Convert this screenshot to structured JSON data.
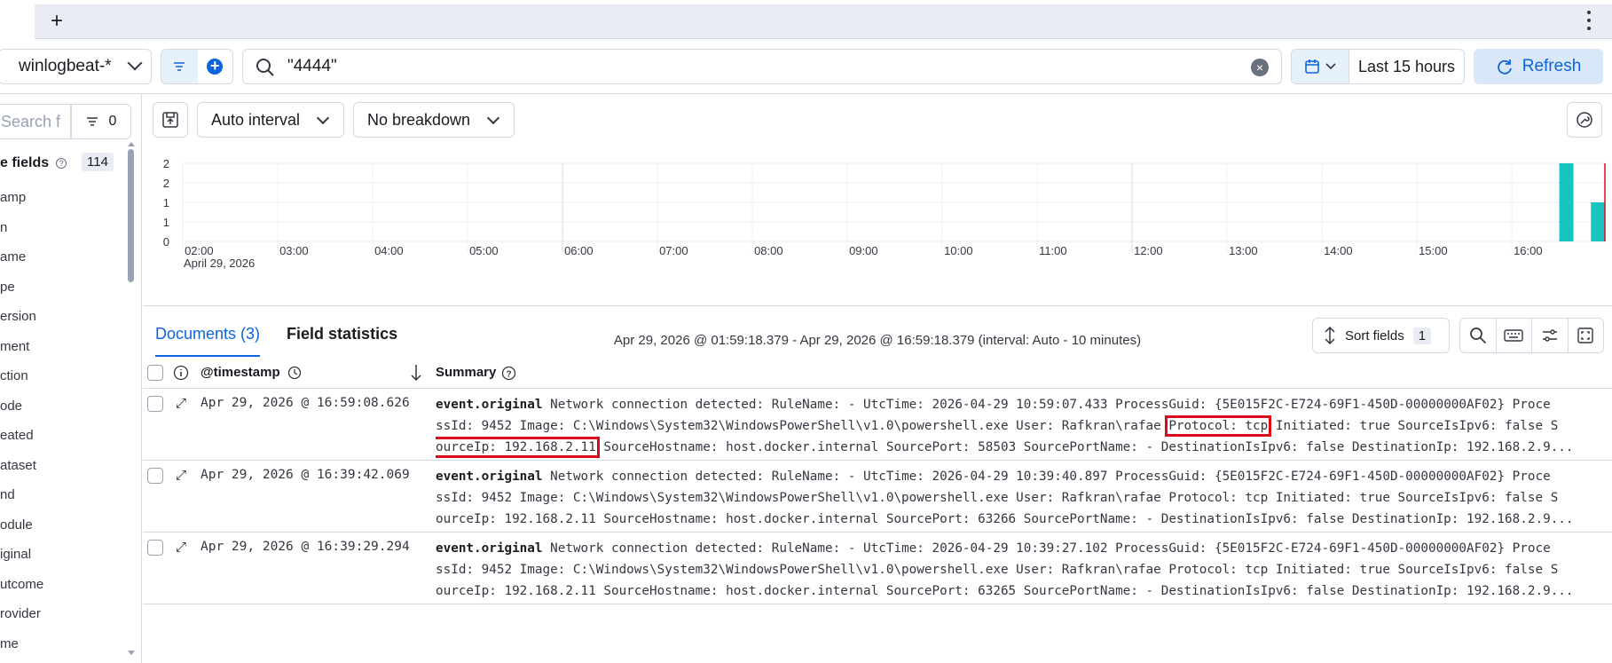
{
  "topbar": {
    "add_tab": "+"
  },
  "querybar": {
    "dataview": "winlogbeat-*",
    "query": "\"4444\"",
    "time_range": "Last 15 hours",
    "refresh": "Refresh"
  },
  "sidebar": {
    "search_placeholder": "Search f",
    "filter_count": "0",
    "section_title": "e fields",
    "section_count": "114",
    "items": [
      "amp",
      "n",
      "ame",
      "pe",
      "ersion",
      "ment",
      "ction",
      "ode",
      "eated",
      "ataset",
      "nd",
      "odule",
      "iginal",
      "utcome",
      "rovider",
      "me"
    ]
  },
  "toolbar": {
    "interval": "Auto interval",
    "breakdown": "No breakdown"
  },
  "chart_data": {
    "type": "bar",
    "y_ticks": [
      "0",
      "1",
      "1",
      "2",
      "2"
    ],
    "x_ticks": [
      "02:00",
      "03:00",
      "04:00",
      "05:00",
      "06:00",
      "07:00",
      "08:00",
      "09:00",
      "10:00",
      "11:00",
      "12:00",
      "13:00",
      "14:00",
      "15:00",
      "16:00"
    ],
    "x_sublabel": "April 29, 2026",
    "bars": [
      {
        "time": "16:30",
        "value": 2
      },
      {
        "time": "16:50",
        "value": 1
      }
    ],
    "ylim": [
      0,
      2
    ],
    "bar_color": "#16c5c0",
    "now_marker_color": "#dd0a1a"
  },
  "histogram": {
    "range_text": "Apr 29, 2026 @ 01:59:18.379 - Apr 29, 2026 @ 16:59:18.379 (interval: Auto - 10 minutes)"
  },
  "tabs": {
    "documents": "Documents (3)",
    "field_stats": "Field statistics"
  },
  "grid": {
    "sort_fields": "Sort fields",
    "sort_count": "1",
    "col_timestamp": "@timestamp",
    "col_summary": "Summary",
    "rows": [
      {
        "timestamp": "Apr 29, 2026 @ 16:59:08.626",
        "key": "event.original",
        "line1": " Network connection detected: RuleName: - UtcTime: 2026-04-29 10:59:07.433 ProcessGuid: {5E015F2C-E724-69F1-450D-00000000AF02} Proce",
        "line2a": "ssId: 9452 Image: C:\\Windows\\System32\\WindowsPowerShell\\v1.0\\powershell.exe User: Rafkran\\rafae ",
        "line2hl": "Protocol: tcp",
        "line2b": " Initiated: true SourceIsIpv6: false S",
        "line3hl": "ourceIp: 192.168.2.11",
        "line3b": " SourceHostname: host.docker.internal SourcePort: 58503 SourcePortName: - DestinationIsIpv6: false DestinationIp: 192.168.2.9..."
      },
      {
        "timestamp": "Apr 29, 2026 @ 16:39:42.069",
        "key": "event.original",
        "line1": " Network connection detected: RuleName: - UtcTime: 2026-04-29 10:39:40.897 ProcessGuid: {5E015F2C-E724-69F1-450D-00000000AF02} Proce",
        "line2": "ssId: 9452 Image: C:\\Windows\\System32\\WindowsPowerShell\\v1.0\\powershell.exe User: Rafkran\\rafae Protocol: tcp Initiated: true SourceIsIpv6: false S",
        "line3": "ourceIp: 192.168.2.11 SourceHostname: host.docker.internal SourcePort: 63266 SourcePortName: - DestinationIsIpv6: false DestinationIp: 192.168.2.9..."
      },
      {
        "timestamp": "Apr 29, 2026 @ 16:39:29.294",
        "key": "event.original",
        "line1": " Network connection detected: RuleName: - UtcTime: 2026-04-29 10:39:27.102 ProcessGuid: {5E015F2C-E724-69F1-450D-00000000AF02} Proce",
        "line2": "ssId: 9452 Image: C:\\Windows\\System32\\WindowsPowerShell\\v1.0\\powershell.exe User: Rafkran\\rafae Protocol: tcp Initiated: true SourceIsIpv6: false S",
        "line3": "ourceIp: 192.168.2.11 SourceHostname: host.docker.internal SourcePort: 63265 SourcePortName: - DestinationIsIpv6: false DestinationIp: 192.168.2.9..."
      }
    ]
  }
}
